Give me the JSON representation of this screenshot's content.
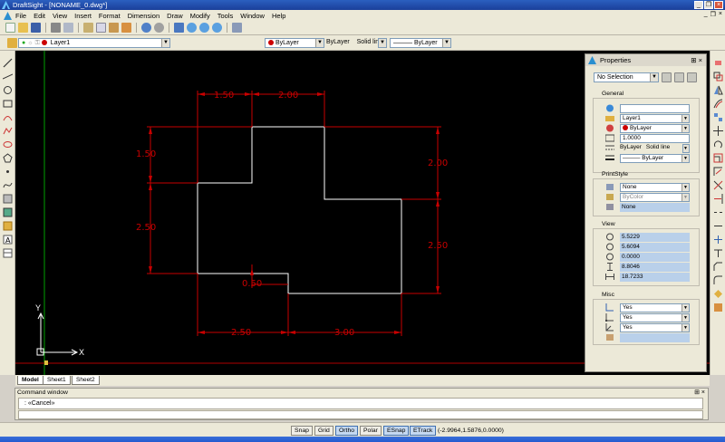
{
  "window": {
    "title": "DraftSight - [NONAME_0.dwg*]"
  },
  "menu": {
    "items": [
      "File",
      "Edit",
      "View",
      "Insert",
      "Format",
      "Dimension",
      "Draw",
      "Modify",
      "Tools",
      "Window",
      "Help"
    ]
  },
  "layers": {
    "current": "Layer1"
  },
  "properties_toolbar": {
    "color": "ByLayer",
    "linetype_label": "ByLayer",
    "linestyle": "Solid line",
    "lineweight": "——— ByLayer"
  },
  "properties_panel": {
    "title": "Properties",
    "selection": "No Selection",
    "general_label": "General",
    "general": {
      "field0": "",
      "layer": "Layer1",
      "color": "ByLayer",
      "scale": "1.0000",
      "linetype": "ByLayer",
      "linetype_style": "Solid line",
      "lineweight": "——— ByLayer"
    },
    "printstyle_label": "PrintStyle",
    "printstyle": {
      "style": "None",
      "color": "ByColor",
      "table": "None"
    },
    "view_label": "View",
    "view": [
      "5.5229",
      "5.6094",
      "0.0000",
      "8.8046",
      "18.7233"
    ],
    "misc_label": "Misc",
    "misc": [
      "Yes",
      "Yes",
      "Yes",
      ""
    ]
  },
  "drawing": {
    "dimensions": [
      "1.50",
      "2.00",
      "1.50",
      "2.50",
      "2.00",
      "2.50",
      "0.50",
      "2.50",
      "3.00"
    ],
    "ucs": {
      "x": "X",
      "y": "Y"
    }
  },
  "tabs": [
    "Model",
    "Sheet1",
    "Sheet2"
  ],
  "command_window": {
    "title": "Command window",
    "history": ": «Cancel»"
  },
  "status": {
    "buttons": [
      {
        "label": "Snap",
        "on": false
      },
      {
        "label": "Grid",
        "on": false
      },
      {
        "label": "Ortho",
        "on": true
      },
      {
        "label": "Polar",
        "on": false
      },
      {
        "label": "ESnap",
        "on": true
      },
      {
        "label": "ETrack",
        "on": true
      }
    ],
    "coordinates": "(-2.9964,1.5876,0.0000)"
  }
}
